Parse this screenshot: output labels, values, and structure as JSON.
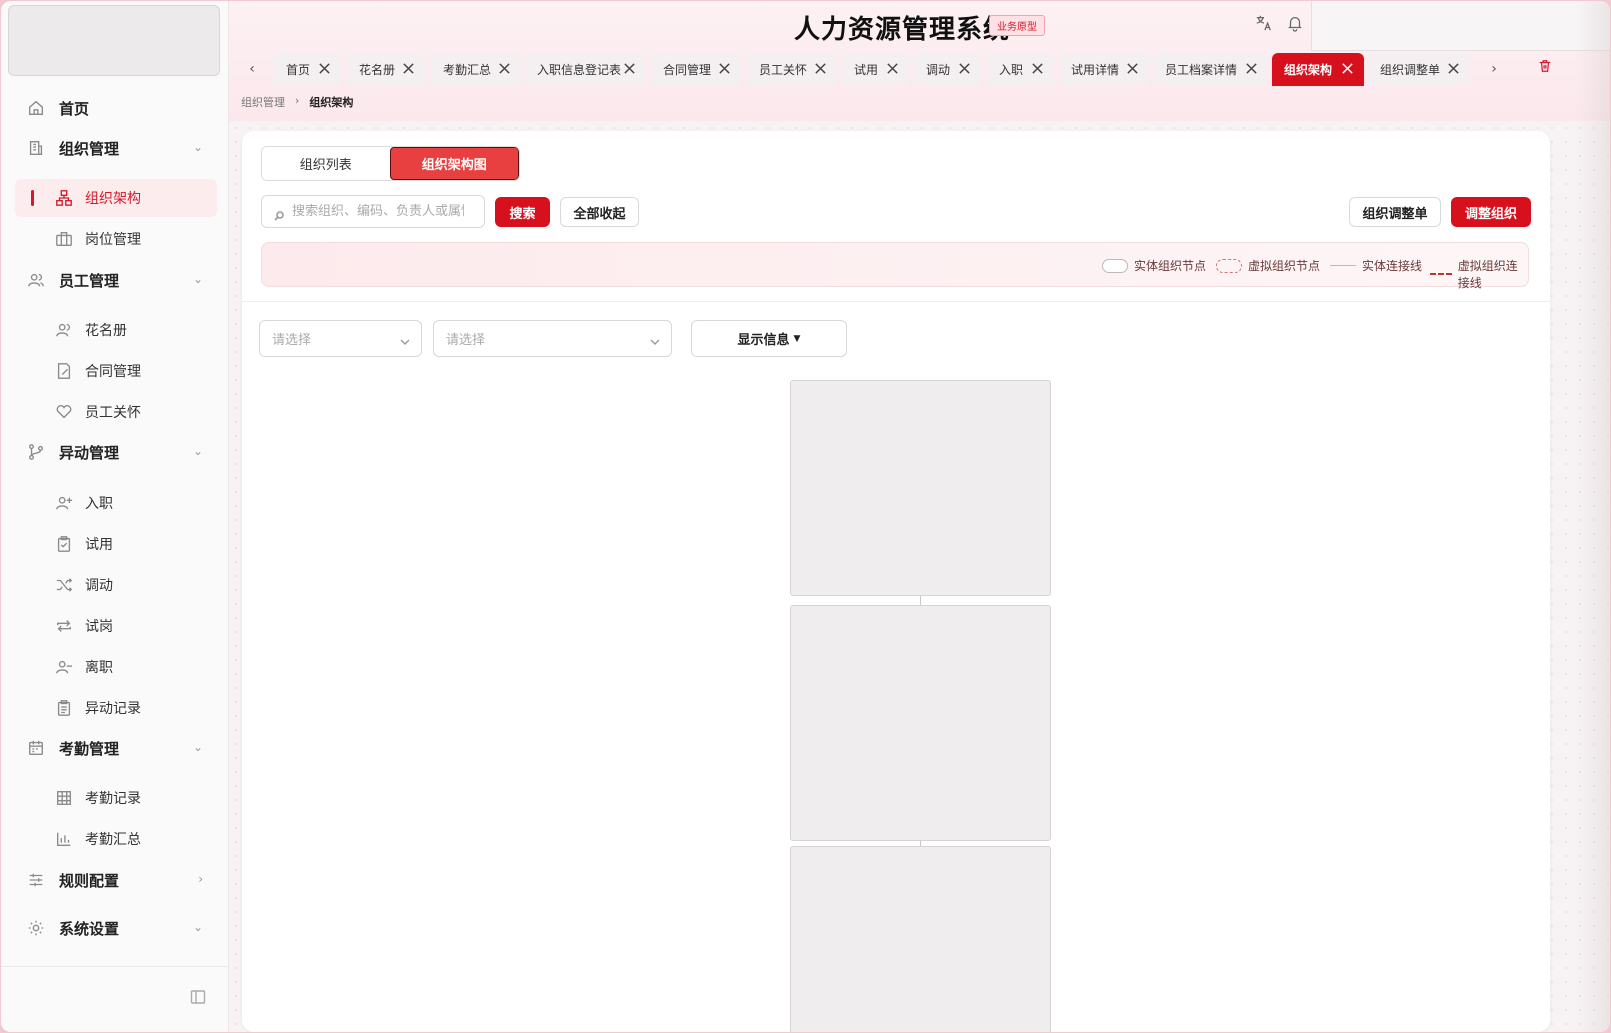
{
  "app": {
    "title": "人力资源管理系统",
    "badge": "业务原型"
  },
  "sidebar": {
    "items": [
      {
        "label": "首页",
        "icon": "home-icon",
        "level": "top"
      },
      {
        "label": "组织管理",
        "icon": "building-icon",
        "level": "top",
        "expanded": true
      },
      {
        "label": "组织架构",
        "icon": "org-chart-icon",
        "level": "sub",
        "active": true
      },
      {
        "label": "岗位管理",
        "icon": "briefcase-icon",
        "level": "sub"
      },
      {
        "label": "员工管理",
        "icon": "users-icon",
        "level": "top",
        "expanded": true
      },
      {
        "label": "花名册",
        "icon": "roster-icon",
        "level": "sub"
      },
      {
        "label": "合同管理",
        "icon": "contract-icon",
        "level": "sub"
      },
      {
        "label": "员工关怀",
        "icon": "heart-hand-icon",
        "level": "sub"
      },
      {
        "label": "异动管理",
        "icon": "branch-icon",
        "level": "top",
        "expanded": true
      },
      {
        "label": "入职",
        "icon": "user-plus-icon",
        "level": "sub"
      },
      {
        "label": "试用",
        "icon": "clipboard-check-icon",
        "level": "sub"
      },
      {
        "label": "调动",
        "icon": "shuffle-icon",
        "level": "sub"
      },
      {
        "label": "试岗",
        "icon": "repeat-icon",
        "level": "sub"
      },
      {
        "label": "离职",
        "icon": "user-minus-icon",
        "level": "sub"
      },
      {
        "label": "异动记录",
        "icon": "clipboard-list-icon",
        "level": "sub"
      },
      {
        "label": "考勤管理",
        "icon": "calendar-icon",
        "level": "top",
        "expanded": true
      },
      {
        "label": "考勤记录",
        "icon": "table-icon",
        "level": "sub"
      },
      {
        "label": "考勤汇总",
        "icon": "bar-chart-icon",
        "level": "sub"
      },
      {
        "label": "规则配置",
        "icon": "sliders-icon",
        "level": "top",
        "expanded": false
      },
      {
        "label": "系统设置",
        "icon": "gear-icon",
        "level": "top",
        "expanded": true
      }
    ]
  },
  "tabs": [
    {
      "label": "首页"
    },
    {
      "label": "花名册"
    },
    {
      "label": "考勤汇总"
    },
    {
      "label": "入职信息登记表"
    },
    {
      "label": "合同管理"
    },
    {
      "label": "员工关怀"
    },
    {
      "label": "试用"
    },
    {
      "label": "调动"
    },
    {
      "label": "入职"
    },
    {
      "label": "试用详情"
    },
    {
      "label": "员工档案详情"
    },
    {
      "label": "组织架构",
      "active": true
    },
    {
      "label": "组织调整单"
    }
  ],
  "breadcrumb": {
    "parent": "组织管理",
    "current": "组织架构"
  },
  "view_switch": {
    "list": "组织列表",
    "chart": "组织架构图",
    "selected": "组织架构图"
  },
  "toolbar": {
    "search_placeholder": "搜索组织、编码、负责人或属性",
    "search_button": "搜索",
    "collapse_all": "全部收起",
    "adjust_form": "组织调整单",
    "adjust_org": "调整组织"
  },
  "legend": {
    "solid_node": "实体组织节点",
    "virtual_node": "虚拟组织节点",
    "solid_line": "实体连接线",
    "virtual_line": "虚拟组织连接线"
  },
  "filters": {
    "select1_placeholder": "请选择",
    "select2_placeholder": "请选择",
    "display_info": "显示信息"
  },
  "colors": {
    "primary": "#d7101e",
    "active_tab": "#d7101e",
    "chart_btn": "#e84040"
  }
}
